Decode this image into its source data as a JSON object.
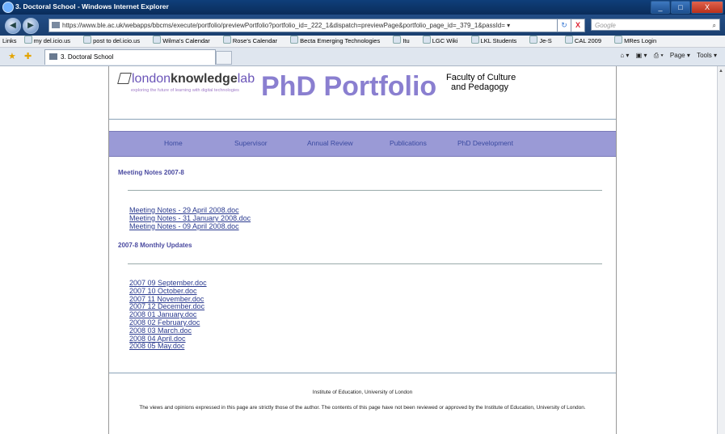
{
  "window": {
    "title": "3. Doctoral School - Windows Internet Explorer",
    "controls": [
      "_",
      "□",
      "X"
    ]
  },
  "address": {
    "url": "https://www.ble.ac.uk/webapps/bbcms/execute/portfolio/previewPortfolio?portfolio_id=_222_1&dispatch=previewPage&portfolio_page_id=_379_1&passId= ▾",
    "search_placeholder": "Google",
    "back": "◀",
    "forward": "▶",
    "refresh": "↻",
    "stop": "X"
  },
  "links_bar": {
    "label": "Links",
    "items": [
      "my del.icio.us",
      "post to del.icio.us",
      "Wilma's Calendar",
      "Rose's Calendar",
      "Becta Emerging Technologies",
      "Itu",
      "LGC Wiki",
      "LKL Students",
      "Je-S",
      "CAL 2009",
      "MRes Login"
    ]
  },
  "tabs": {
    "active": "3. Doctoral School",
    "commands": [
      "Page ▾",
      "Tools ▾"
    ]
  },
  "page": {
    "logo_text_1": "london",
    "logo_text_2": "knowledge",
    "logo_text_3": "lab",
    "tagline": "exploring the future of learning with digital technologies",
    "title": "PhD Portfolio",
    "faculty_line1": "Faculty of Culture",
    "faculty_line2": "and Pedagogy",
    "nav": [
      "Home",
      "Supervisor",
      "Annual Review",
      "Publications",
      "PhD Development"
    ],
    "section1": {
      "heading": "Meeting Notes 2007-8",
      "links": [
        "Meeting Notes - 29 April 2008.doc",
        "Meeting Notes - 31 January 2008.doc",
        "Meeting Notes - 09 April 2008.doc"
      ]
    },
    "section2": {
      "heading": "2007-8 Monthly Updates",
      "links": [
        "2007 09 September.doc",
        "2007 10 October.doc",
        "2007 11 November.doc",
        "2007 12 December.doc",
        "2008 01 January.doc",
        "2008 02 February.doc",
        "2008 03 March.doc",
        "2008 04 April.doc",
        "2008 05 May.doc"
      ]
    },
    "footer": {
      "institution": "Institute of Education, University of London",
      "disclaimer": "The views and opinions expressed in this page are strictly those of the author. The contents of this page have not been reviewed or approved by the Institute of Education, University of London."
    }
  }
}
